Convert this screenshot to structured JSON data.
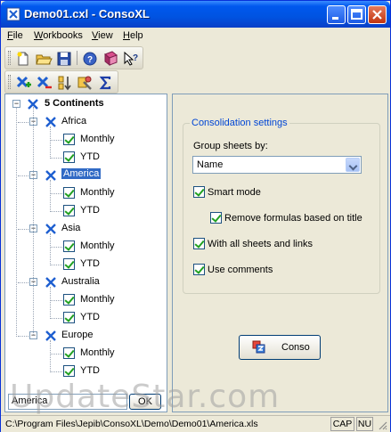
{
  "window": {
    "title": "Demo01.cxl - ConsoXL"
  },
  "menu": [
    {
      "key": "F",
      "rest": "ile"
    },
    {
      "key": "W",
      "rest": "orkbooks"
    },
    {
      "key": "V",
      "rest": "iew"
    },
    {
      "key": "H",
      "rest": "elp"
    }
  ],
  "tree": {
    "root": "5 Continents",
    "continents": [
      {
        "name": "Africa",
        "items": [
          "Monthly",
          "YTD"
        ]
      },
      {
        "name": "America",
        "items": [
          "Monthly",
          "YTD"
        ]
      },
      {
        "name": "Asia",
        "items": [
          "Monthly",
          "YTD"
        ]
      },
      {
        "name": "Australia",
        "items": [
          "Monthly",
          "YTD"
        ]
      },
      {
        "name": "Europe",
        "items": [
          "Monthly",
          "YTD"
        ]
      }
    ]
  },
  "bottom": {
    "input_value": "America",
    "ok_label": "OK"
  },
  "settings": {
    "group_title": "Consolidation settings",
    "group_sheets_label": "Group sheets by:",
    "group_sheets_value": "Name",
    "smart_mode": "Smart mode",
    "remove_formulas": "Remove formulas based on title",
    "all_sheets_links": "With all sheets and links",
    "use_comments": "Use comments",
    "conso_label": "Conso"
  },
  "status": {
    "path": "C:\\Program Files\\Jepib\\ConsoXL\\Demo\\Demo01\\America.xls",
    "cap": "CAP",
    "nu": "NU"
  },
  "watermark": "UpdateStar.com"
}
